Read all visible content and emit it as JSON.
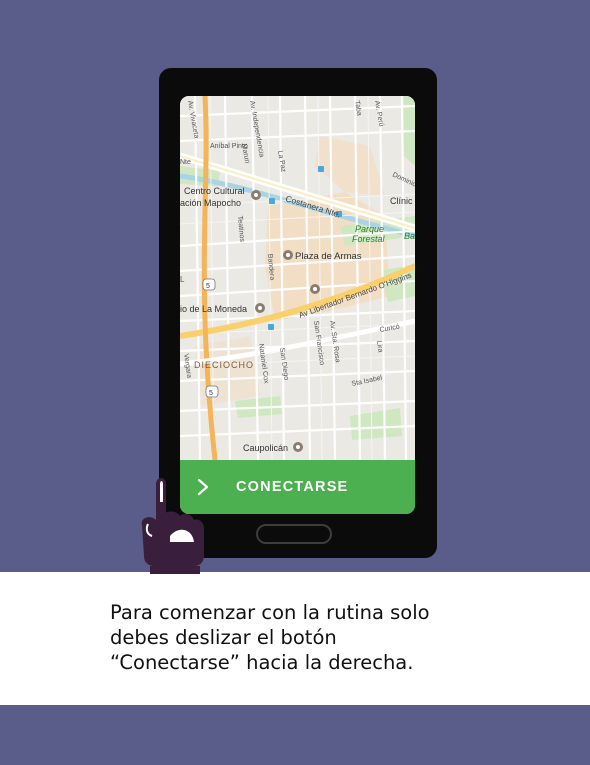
{
  "map": {
    "places": {
      "centro_cultural_1": "Centro Cultural",
      "centro_cultural_2": "ación Mapocho",
      "plaza_de_armas": "Plaza de Armas",
      "la_moneda": "io de La Moneda",
      "caupolican": "Caupolicán",
      "clinic": "Clínic",
      "parque_forestal_1": "Parque",
      "parque_forestal_2": "Forestal",
      "ba": "Ba",
      "dieciocho": "DIECIOCHO"
    },
    "streets": {
      "vivaceta": "Av. Vivaceta",
      "independencia": "Av. Independencia",
      "anibal_pinto": "Aníbal Pinto",
      "maruri": "Maruri",
      "la_paz": "La Paz",
      "tabara": "Taba",
      "av_peru": "Av. Perú",
      "dominica": "Dominica",
      "costanera": "Costanera Nte.",
      "teatinos": "Teatinos",
      "bandera": "Bandera",
      "libertador": "Av Libertador Bernardo O'Higgins",
      "san_francisco": "San Francisco",
      "sta_rosa": "Av. Sta. Rosa",
      "curico": "Curicó",
      "lira": "Lira",
      "sta_isabel": "Sta Isabel",
      "nataniel_cox": "Nataniel Cox",
      "san_diego": "San Diego",
      "vergara": "Vergara",
      "ruta_5": "5",
      "nte": "Nte",
      "l": "L"
    }
  },
  "button": {
    "label": "CONECTARSE",
    "arrow": "›",
    "color": "#4caf50"
  },
  "caption": {
    "line1": "Para comenzar con la rutina solo",
    "line2": "debes deslizar el botón",
    "line3": "“Conectarse” hacia la derecha."
  },
  "colors": {
    "background": "#5a5c8a",
    "caption_band": "#ffffff",
    "hand": "#3a1f3d"
  },
  "icons": [
    "chevron-right-icon",
    "hand-pointer-icon",
    "museum-pin-icon",
    "metro-icon",
    "highway-shield-icon"
  ]
}
